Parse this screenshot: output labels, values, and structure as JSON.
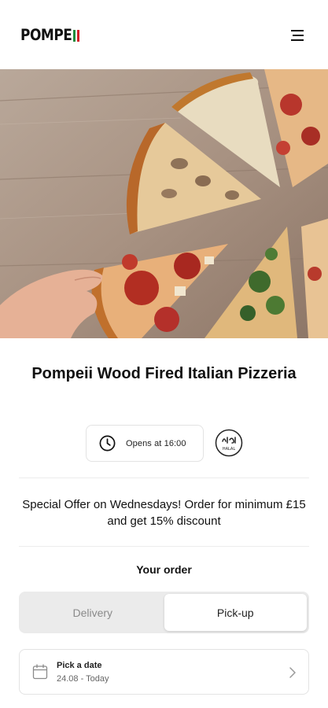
{
  "header": {
    "logo_text": "POMPE",
    "logo_colors": {
      "green": "#1f8a3b",
      "red": "#d4202a"
    },
    "menu_icon": "hamburger-menu-icon"
  },
  "hero": {
    "image": "pizza-slices-photo"
  },
  "restaurant": {
    "name": "Pompeii Wood Fired Italian Pizzeria",
    "hours_label": "Opens at 16:00",
    "halal_badge_text": "HALAL",
    "icons": {
      "hours": "clock-icon",
      "halal": "halal-icon"
    }
  },
  "offer": {
    "text": "Special Offer on Wednesdays! Order for minimum £15 and get 15% discount"
  },
  "order": {
    "heading": "Your order",
    "tabs": [
      {
        "label": "Delivery",
        "active": false
      },
      {
        "label": "Pick-up",
        "active": true
      }
    ],
    "date_picker": {
      "label": "Pick a date",
      "value": "24.08 - Today",
      "icons": {
        "calendar": "calendar-icon",
        "chevron": "chevron-right-icon"
      }
    }
  }
}
